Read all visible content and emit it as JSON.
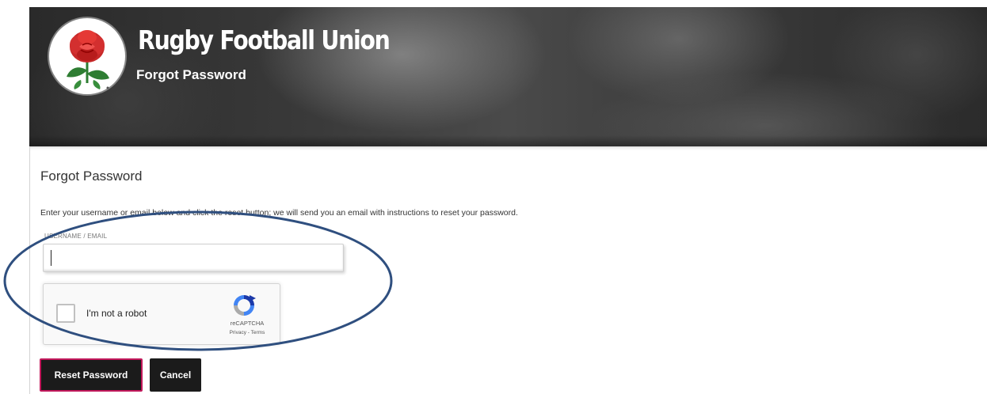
{
  "header": {
    "brand": "Rugby Football Union",
    "subtitle": "Forgot Password",
    "logo_icon": "red-rose-emblem-icon"
  },
  "panel": {
    "title": "Forgot Password",
    "instructions": "Enter your username or email below and click the reset button; we will send you an email with instructions to reset your password.",
    "field_label": "USERNAME / EMAIL",
    "field_value": ""
  },
  "recaptcha": {
    "label": "I'm not a robot",
    "brand": "reCAPTCHA",
    "links": "Privacy - Terms",
    "icon": "recaptcha-icon"
  },
  "buttons": {
    "reset": "Reset Password",
    "cancel": "Cancel"
  },
  "colors": {
    "button_bg": "#1b1b1b",
    "button_focus_border": "#c2185b",
    "annotation_stroke": "#2f4f7f",
    "rose_red": "#d32030",
    "leaf_green": "#2e7d32"
  }
}
